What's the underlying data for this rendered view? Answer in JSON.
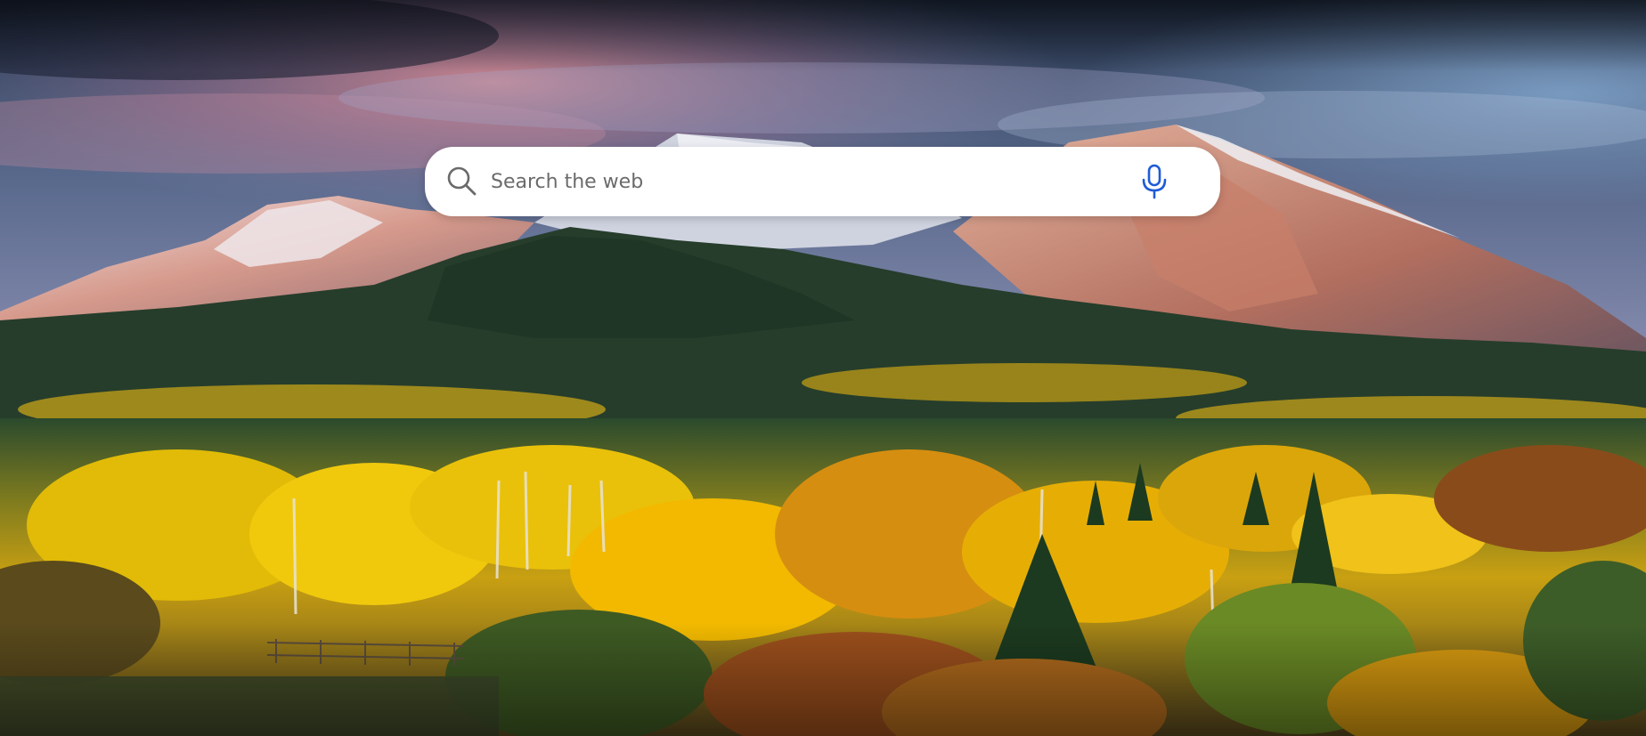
{
  "background": {
    "image": "mountain-autumn-landscape",
    "colors": {
      "sky_top": "#2f3f58",
      "sky_glow": "#d9898f",
      "sky_right": "#6f90b8",
      "snow": "#e9e7ee",
      "mountain_shadow": "#5d5a66",
      "conifer": "#223a25",
      "aspen_yellow": "#e6b800",
      "autumn_orange": "#b8621e"
    }
  },
  "search": {
    "placeholder": "Search the web",
    "value": "",
    "search_icon": "search-icon",
    "voice_icon": "microphone-icon",
    "icon_color": "#6a6a6a",
    "mic_color": "#1f5bd6"
  }
}
